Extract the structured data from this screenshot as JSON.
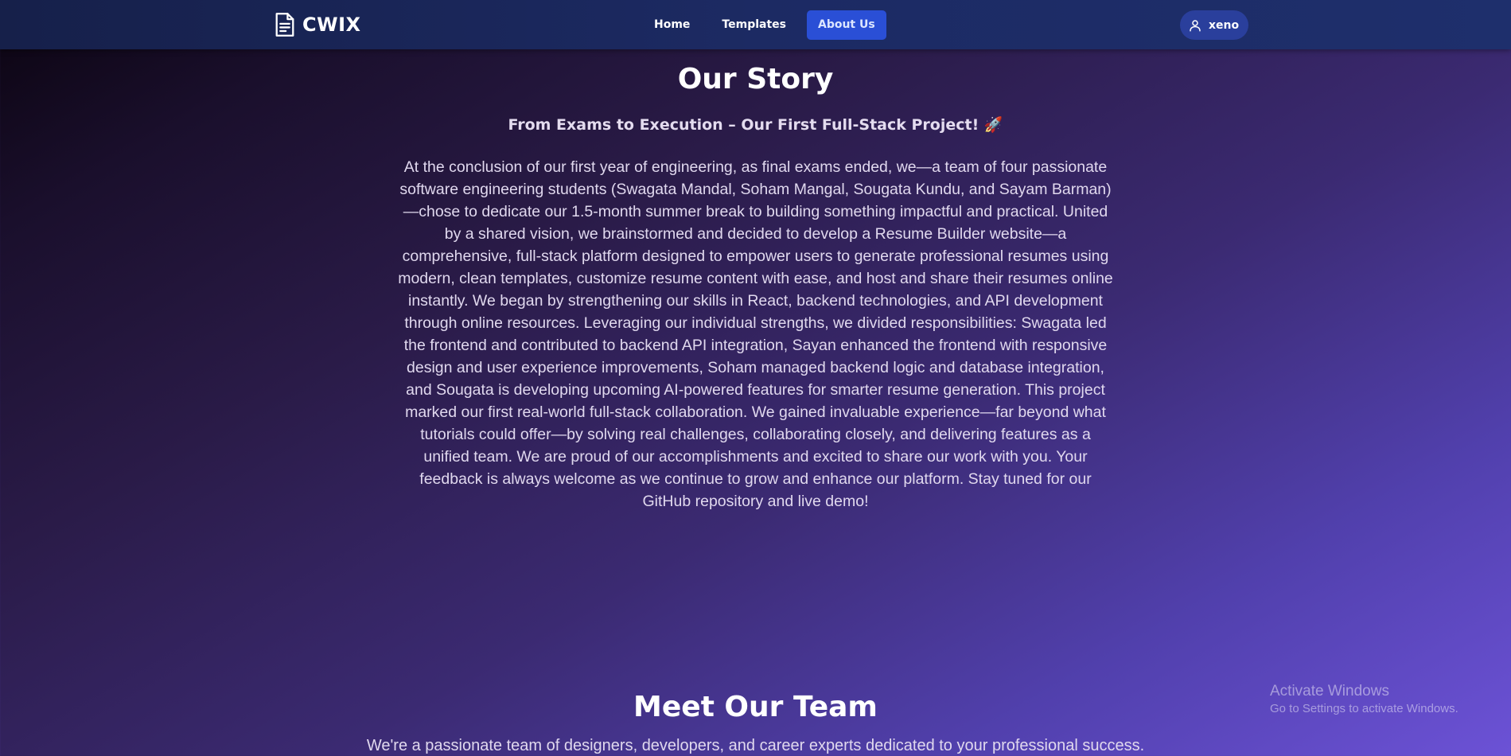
{
  "nav": {
    "brand": "CWIX",
    "brand_icon": "document-icon",
    "links": [
      {
        "label": "Home",
        "active": false
      },
      {
        "label": "Templates",
        "active": false
      },
      {
        "label": "About Us",
        "active": true
      }
    ],
    "user": {
      "name": "xeno",
      "icon": "user-icon"
    }
  },
  "story": {
    "title": "Our Story",
    "subtitle": "From Exams to Execution – Our First Full-Stack Project! 🚀",
    "body": "At the conclusion of our first year of engineering, as final exams ended, we—a team of four passionate software engineering students (Swagata Mandal, Soham Mangal, Sougata Kundu, and Sayam Barman)—chose to dedicate our 1.5-month summer break to building something impactful and practical. United by a shared vision, we brainstormed and decided to develop a Resume Builder website—a comprehensive, full-stack platform designed to empower users to generate professional resumes using modern, clean templates, customize resume content with ease, and host and share their resumes online instantly. We began by strengthening our skills in React, backend technologies, and API development through online resources. Leveraging our individual strengths, we divided responsibilities: Swagata led the frontend and contributed to backend API integration, Sayan enhanced the frontend with responsive design and user experience improvements, Soham managed backend logic and database integration, and Sougata is developing upcoming AI-powered features for smarter resume generation. This project marked our first real-world full-stack collaboration. We gained invaluable experience—far beyond what tutorials could offer—by solving real challenges, collaborating closely, and delivering features as a unified team. We are proud of our accomplishments and excited to share our work with you. Your feedback is always welcome as we continue to grow and enhance our platform. Stay tuned for our GitHub repository and live demo!"
  },
  "team": {
    "title": "Meet Our Team",
    "intro": "We're a passionate team of designers, developers, and career experts dedicated to your professional success."
  },
  "watermark": {
    "title": "Activate Windows",
    "subtitle": "Go to Settings to activate Windows."
  },
  "colors": {
    "navbar": "#1c2a63",
    "active_link": "#2a4fd6",
    "user_pill": "#2a3f9c",
    "background_dark": "#0b0410",
    "background_light": "#6c52d6"
  }
}
